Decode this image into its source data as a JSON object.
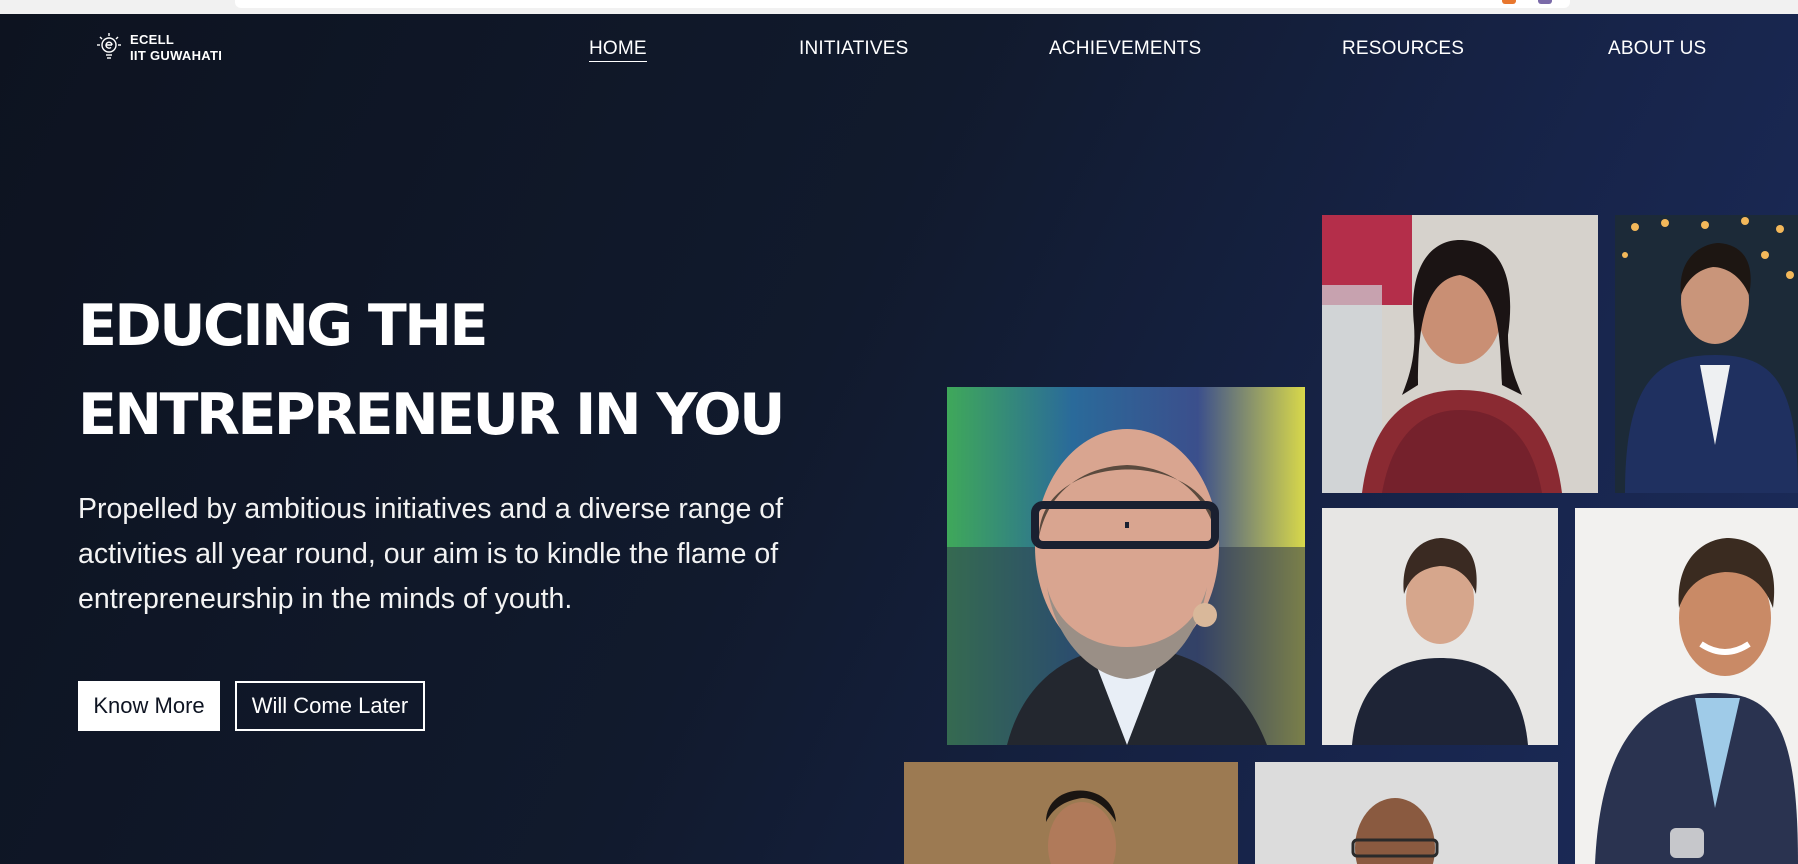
{
  "brand": {
    "line1": "ECELL",
    "line2": "IIT GUWAHATI",
    "logo_icon": "lightbulb-e-icon"
  },
  "nav": {
    "items": [
      {
        "label": "HOME",
        "active": true
      },
      {
        "label": "INITIATIVES",
        "active": false
      },
      {
        "label": "ACHIEVEMENTS",
        "active": false
      },
      {
        "label": "RESOURCES",
        "active": false
      },
      {
        "label": "ABOUT US",
        "active": false
      }
    ]
  },
  "hero": {
    "title_line1": "EDUCING THE",
    "title_line2": "ENTREPRENEUR IN YOU",
    "description": "Propelled by ambitious initiatives and a diverse range of activities all year round, our aim is to kindle the flame of entrepreneurship in the minds of youth.",
    "primary_button": "Know More",
    "secondary_button": "Will Come Later"
  },
  "colors": {
    "background_dark": "#0d1320",
    "background_blue": "#1c2c5c",
    "text": "#ffffff"
  }
}
